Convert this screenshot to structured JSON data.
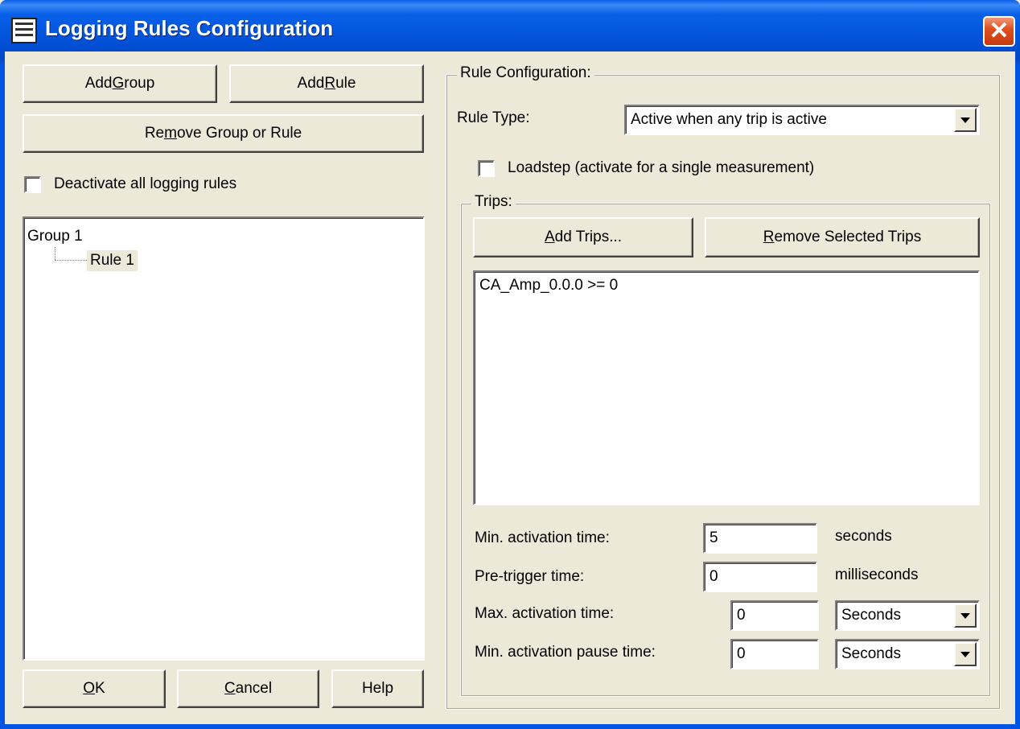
{
  "window": {
    "title": "Logging Rules Configuration",
    "close_glyph": "✕"
  },
  "left": {
    "add_group": {
      "pre": "Add ",
      "key": "G",
      "post": "roup"
    },
    "add_rule": {
      "pre": "Add ",
      "key": "R",
      "post": "ule"
    },
    "remove_group_rule": {
      "pre": "Re",
      "key": "m",
      "post": "ove Group or Rule"
    },
    "deactivate_label": "Deactivate all logging rules",
    "tree": {
      "group_label": "Group 1",
      "rule_label": "Rule 1"
    },
    "ok": {
      "pre": "",
      "key": "O",
      "post": "K"
    },
    "cancel": {
      "pre": "",
      "key": "C",
      "post": "ancel"
    },
    "help": "Help"
  },
  "rule_config": {
    "legend": "Rule Configuration:",
    "rule_type_label": "Rule Type:",
    "rule_type_value": "Active when any trip is active",
    "loadstep_label": "Loadstep (activate for a single measurement)",
    "trips": {
      "legend": "Trips:",
      "add_trips": {
        "pre": "",
        "key": "A",
        "post": "dd Trips..."
      },
      "remove_trips": {
        "pre": "",
        "key": "R",
        "post": "emove Selected Trips"
      },
      "items": [
        "CA_Amp_0.0.0 >= 0"
      ]
    },
    "min_activation": {
      "label": "Min. activation time:",
      "value": "5",
      "unit": "seconds"
    },
    "pre_trigger": {
      "label": "Pre-trigger time:",
      "value": "0",
      "unit": "milliseconds"
    },
    "max_activation": {
      "label": "Max. activation time:",
      "value": "0",
      "unit": "Seconds"
    },
    "min_pause": {
      "label": "Min. activation pause time:",
      "value": "0",
      "unit": "Seconds"
    }
  }
}
